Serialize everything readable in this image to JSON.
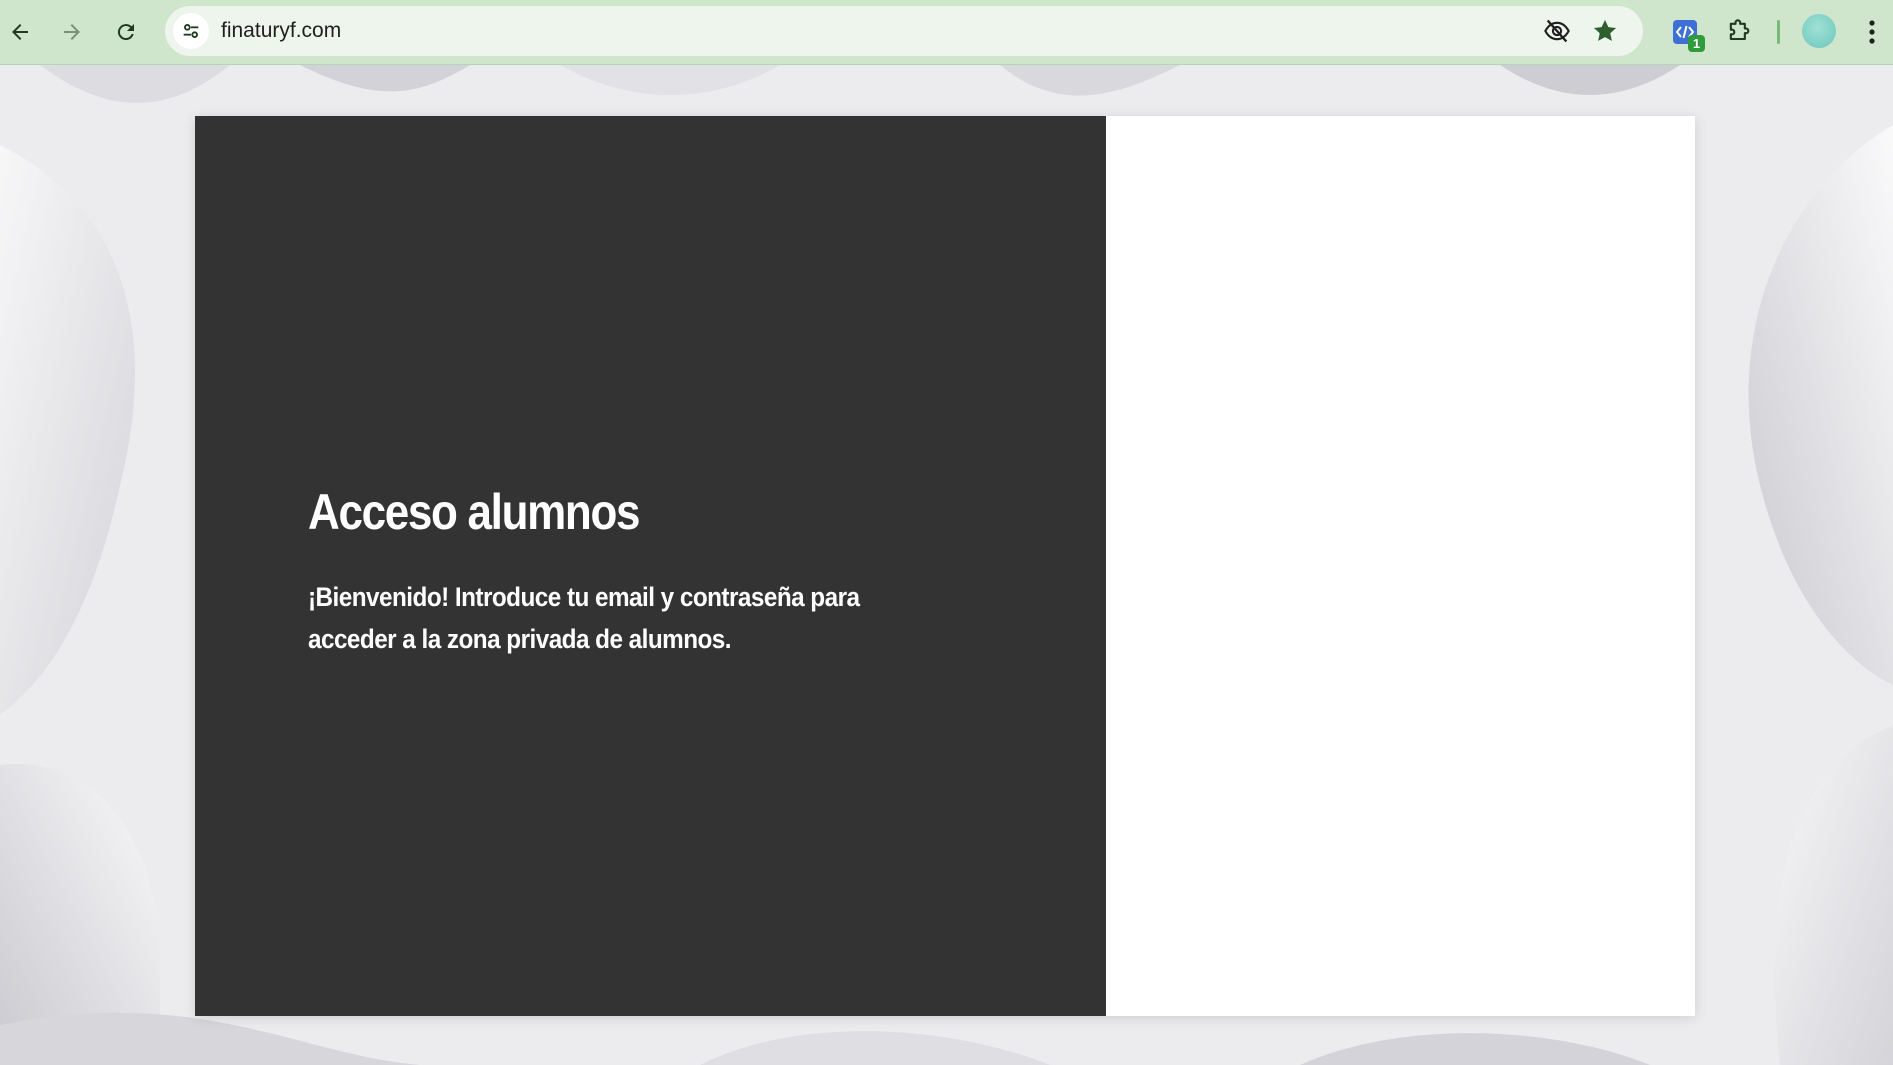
{
  "browser": {
    "url": "finaturyf.com",
    "extension_badge": "1",
    "icons": {
      "back": "arrow-left-icon",
      "forward": "arrow-right-icon",
      "reload": "reload-icon",
      "site_info": "tune-icon",
      "tracking": "eye-off-icon",
      "bookmark": "star-icon",
      "extension": "code-extension-icon",
      "extensions": "puzzle-icon",
      "menu": "kebab-menu-icon"
    },
    "colors": {
      "toolbar": "#cfe5cc",
      "omnibox": "#eef5ec",
      "bookmark_star": "#2f5f2f",
      "badge": "#2e9c3a"
    }
  },
  "page": {
    "title": "Acceso alumnos",
    "welcome_text": "¡Bienvenido! Introduce tu email y contraseña para acceder a la zona privada de alumnos.",
    "colors": {
      "left_panel": "#333333",
      "right_panel": "#ffffff",
      "text": "#ffffff"
    }
  }
}
